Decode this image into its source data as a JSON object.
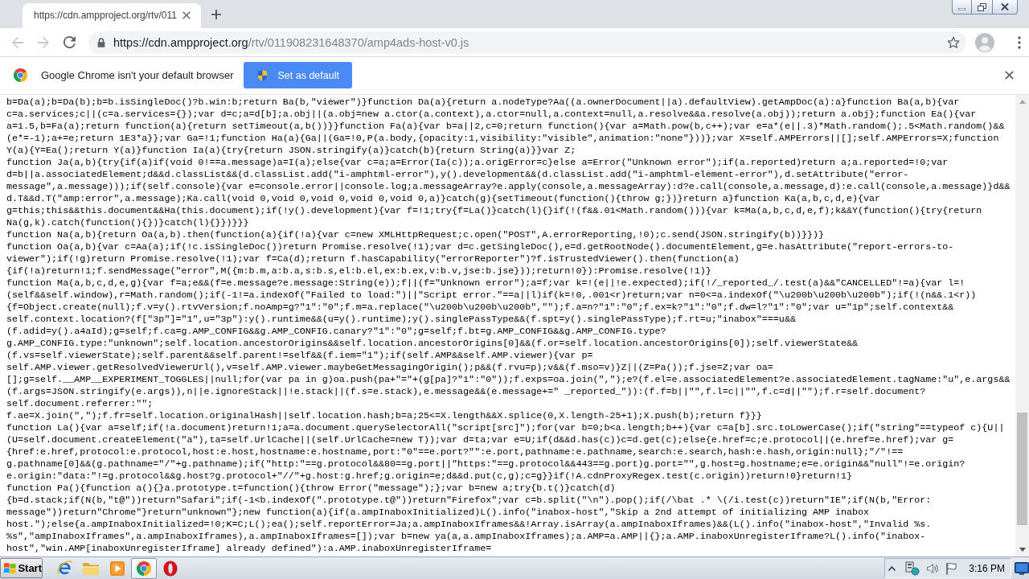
{
  "tabs": [
    {
      "title": "https://cdn.ampproject.org/rtv/011",
      "selected": true
    }
  ],
  "toolbar": {
    "nav_buttons": [
      {
        "kind": "back",
        "disabled": true
      },
      {
        "kind": "forward",
        "disabled": true
      },
      {
        "kind": "reload",
        "disabled": false
      }
    ],
    "url": {
      "origin": "https://cdn.ampproject.org",
      "path": "/rtv/011908231648370/amp4ads-host-v0.js"
    }
  },
  "infobar": {
    "message": "Google Chrome isn't your default browser",
    "button": "Set as default"
  },
  "document": {
    "lines": [
      "b=Da(a);b=Da(b);b=b.isSingleDoc()?b.win:b;return Ba(b,\"viewer\")}function Da(a){return a.nodeType?Aa((a.ownerDocument||a).defaultView).getAmpDoc(a):a}function Ba(a,b){var",
      "c=a.services;c||(c=a.services={});var d=c;a=d[b];a.obj||(a.obj=new a.ctor(a.context),a.ctor=null,a.context=null,a.resolve&&a.resolve(a.obj));return a.obj};function Ea(){var",
      "a=1.5,b=Fa(a);return function(a){return setTimeout(a,b())}}function Fa(a){var b=a||2,c=0;return function(){var a=Math.pow(b,c++);var e=a*(e||.3)*Math.random();.5<Math.random()&&",
      "(e*=-1);a+=e;return 1E3*a}};var Ga=!1;function Ha(a){Ga||(Ga=!0,P(a.body,{opacity:1,visibility:\"visible\",animation:\"none\"}))};var X=self.AMPErrors||[];self.AMPErrors=X;function",
      "Y(a){Y=Ea();return Y(a)}function Ia(a){try{return JSON.stringify(a)}catch(b){return String(a)}}var Z;",
      "function Ja(a,b){try{if(a)if(void 0!==a.message)a=I(a);else{var c=a;a=Error(Ia(c));a.origError=c}else a=Error(\"Unknown error\");if(a.reported)return a;a.reported=!0;var",
      "d=b||a.associatedElement;d&&d.classList&&(d.classList.add(\"i-amphtml-error\"),y().development&&(d.classList.add(\"i-amphtml-element-error\"),d.setAttribute(\"error-",
      "message\",a.message)));if(self.console){var e=console.error||console.log;a.messageArray?e.apply(console,a.messageArray):d?e.call(console,a.message,d):e.call(console,a.message)}d&&",
      "d.T&&d.T(\"amp:error\",a.message);Ka.call(void 0,void 0,void 0,void 0,void 0,a)}catch(g){setTimeout(function(){throw g;})}return a}function Ka(a,b,c,d,e){var",
      "g=this;this&&this.document&&Ha(this.document);if(!y().development){var f=!1;try{f=La()}catch(l){}if(!(f&&.01<Math.random())){var k=Ma(a,b,c,d,e,f);k&&Y(function(){try{return",
      "Na(g,k).catch(function(){})}catch(l){}})}}}",
      "function Na(a,b){return Oa(a,b).then(function(a){if(!a){var c=new XMLHttpRequest;c.open(\"POST\",A.errorReporting,!0);c.send(JSON.stringify(b))}})}",
      "function Oa(a,b){var c=Aa(a);if(!c.isSingleDoc())return Promise.resolve(!1);var d=c.getSingleDoc(),e=d.getRootNode().documentElement,g=e.hasAttribute(\"report-errors-to-",
      "viewer\");if(!g)return Promise.resolve(!1);var f=Ca(d);return f.hasCapability(\"errorReporter\")?f.isTrustedViewer().then(function(a)",
      "{if(!a)return!1;f.sendMessage(\"error\",M({m:b.m,a:b.a,s:b.s,el:b.el,ex:b.ex,v:b.v,jse:b.jse}));return!0}):Promise.resolve(!1)}",
      "function Ma(a,b,c,d,e,g){var f=a;e&&(f=e.message?e.message:String(e));f||(f=\"Unknown error\");a=f;var k=!(e||!e.expected);if(!/_reported_/.test(a)&&\"CANCELLED\"!=a){var l=!",
      "(self&&self.window),r=Math.random();if(-1!=a.indexOf(\"Failed to load:\")||\"Script error.\"==a||l)if(k=!0,.001<r)return;var n=0<=a.indexOf(\"\\u200b\\u200b\\u200b\");if(!(n&&.1<r))",
      "{f=Object.create(null);f.v=y().rtvVersion;f.noAmp=g?\"1\":\"0\";f.m=a.replace(\"\\u200b\\u200b\\u200b\",\"\");f.a=n?\"1\":\"0\";f.ex=k?\"1\":\"0\";f.dw=l?\"1\":\"0\";var u=\"1p\";self.context&&",
      "self.context.location?(f[\"3p\"]=\"1\",u=\"3p\"):y().runtime&&(u=y().runtime);y().singlePassType&&(f.spt=y().singlePassType);f.rt=u;\"inabox\"===u&&",
      "(f.adid=y().a4aId);g=self;f.ca=g.AMP_CONFIG&&g.AMP_CONFIG.canary?\"1\":\"0\";g=self;f.bt=g.AMP_CONFIG&&g.AMP_CONFIG.type?",
      "g.AMP_CONFIG.type:\"unknown\";self.location.ancestorOrigins&&self.location.ancestorOrigins[0]&&(f.or=self.location.ancestorOrigins[0]);self.viewerState&&",
      "(f.vs=self.viewerState);self.parent&&self.parent!=self&&(f.iem=\"1\");if(self.AMP&&self.AMP.viewer){var p=",
      "self.AMP.viewer.getResolvedViewerUrl(),v=self.AMP.viewer.maybeGetMessagingOrigin();p&&(f.rvu=p);v&&(f.mso=v)}Z||(Z=Pa());f.jse=Z;var oa=",
      "[];g=self.__AMP__EXPERIMENT_TOGGLES||null;for(var pa in g)oa.push(pa+\"=\"+(g[pa]?\"1\":\"0\"));f.exps=oa.join(\",\");e?(f.el=e.associatedElement?e.associatedElement.tagName:\"u\",e.args&&",
      "(f.args=JSON.stringify(e.args)),n||e.ignoreStack||!e.stack||(f.s=e.stack),e.message&&(e.message+=\" _reported_\")):(f.f=b||\"\",f.l=c||\"\",f.c=d||\"\");f.r=self.document?",
      "self.document.referrer:\"\";",
      "f.ae=X.join(\",\");f.fr=self.location.originalHash||self.location.hash;b=a;25<=X.length&&X.splice(0,X.length-25+1);X.push(b);return f}}}",
      "function La(){var a=self;if(!a.document)return!1;a=a.document.querySelectorAll(\"script[src]\");for(var b=0;b<a.length;b++){var c=a[b].src.toLowerCase();if(\"string\"==typeof c){U||",
      "(U=self.document.createElement(\"a\"),ta=self.UrlCache||(self.UrlCache=new T));var d=ta;var e=U;if(d&&d.has(c))c=d.get(c);else{e.href=c;e.protocol||(e.href=e.href);var g=",
      "{href:e.href,protocol:e.protocol,host:e.host,hostname:e.hostname,port:\"0\"==e.port?\"\":e.port,pathname:e.pathname,search:e.search,hash:e.hash,origin:null};\"/\"!==",
      "g.pathname[0]&&(g.pathname=\"/\"+g.pathname);if(\"http:\"==g.protocol&&80==g.port||\"https:\"==g.protocol&&443==g.port)g.port=\"\",g.host=g.hostname;e=e.origin&&\"null\"!=e.origin?",
      "e.origin:\"data:\"!=g.protocol&&g.host?g.protocol+\"//\"+g.host:g.href;g.origin=e;d&&d.put(c,g);c=g}}if(!A.cdnProxyRegex.test(c.origin))return!0}return!1}",
      "function Pa(){function a(){}a.prototype.t=function(){throw Error(\"message\");};var b=new a;try{b.t()}catch(d)",
      "{b=d.stack;if(N(b,\"t@\"))return\"Safari\";if(-1<b.indexOf(\".prototype.t@\"))return\"Firefox\";var c=b.split(\"\\n\").pop();if(/\\bat .* \\(/i.test(c))return\"IE\";if(N(b,\"Error:",
      "message\"))return\"Chrome\"}return\"unknown\"};new function(a){if(a.ampInaboxInitialized)L().info(\"inabox-host\",\"Skip a 2nd attempt of initializing AMP inabox",
      "host.\");else{a.ampInaboxInitialized=!0;K=C;L();ea();self.reportError=Ja;a.ampInaboxIframes&&!Array.isArray(a.ampInaboxIframes)&&(L().info(\"inabox-host\",\"Invalid %s.",
      "%s\",\"ampInaboxIframes\",a.ampInaboxIframes),a.ampInaboxIframes=[]);var b=new ya(a,a.ampInaboxIframes);a.AMP=a.AMP||{};a.AMP.inaboxUnregisterIframe?L().info(\"inabox-",
      "host\",\"win.AMP[inaboxUnregisterIframe] already defined\"):a.AMP.inaboxUnregisterIframe="
    ]
  },
  "taskbar": {
    "start": "Start",
    "apps": [
      {
        "kind": "ie",
        "selected": false
      },
      {
        "kind": "folder",
        "selected": false
      },
      {
        "kind": "media",
        "selected": false
      },
      {
        "kind": "chrome",
        "selected": true
      },
      {
        "kind": "ring",
        "selected": false
      }
    ],
    "clock": "3:16 PM"
  }
}
